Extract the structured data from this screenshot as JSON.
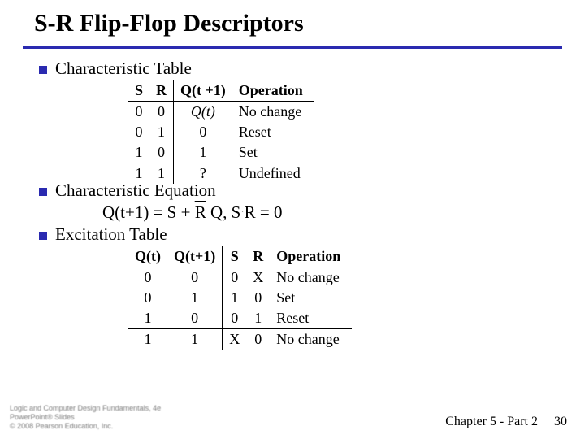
{
  "title": "S-R Flip-Flop Descriptors",
  "sections": {
    "char_table": "Characteristic Table",
    "char_eq": "Characteristic Equation",
    "excite": "Excitation Table"
  },
  "char_table": {
    "headers": {
      "s": "S",
      "r": "R",
      "q": "Q(t +1)",
      "op": "Operation"
    },
    "rows": [
      {
        "s": "0",
        "r": "0",
        "q": "Q(t)",
        "q_italic": true,
        "op": "No change"
      },
      {
        "s": "0",
        "r": "1",
        "q": "0",
        "q_italic": false,
        "op": "Reset"
      },
      {
        "s": "1",
        "r": "0",
        "q": "1",
        "q_italic": false,
        "op": "Set"
      }
    ],
    "last": {
      "s": "1",
      "r": "1",
      "q": "?",
      "op": "Undefined"
    }
  },
  "equation": {
    "lhs": "Q(t+1) = S + ",
    "rbar": "R",
    "mid": " Q, S",
    "dot": "·",
    "rhs": "R = 0"
  },
  "excite_table": {
    "headers": {
      "qt": "Q(t)",
      "qt1": "Q(t+1)",
      "s": "S",
      "r": "R",
      "op": "Operation"
    },
    "rows": [
      {
        "qt": "0",
        "qt1": "0",
        "s": "0",
        "r": "X",
        "op": "No change"
      },
      {
        "qt": "0",
        "qt1": "1",
        "s": "1",
        "r": "0",
        "op": "Set"
      },
      {
        "qt": "1",
        "qt1": "0",
        "s": "0",
        "r": "1",
        "op": "Reset"
      }
    ],
    "last": {
      "qt": "1",
      "qt1": "1",
      "s": "X",
      "r": "0",
      "op": "No change"
    }
  },
  "attribution": {
    "l1": "Logic and Computer Design Fundamentals, 4e",
    "l2": "PowerPoint® Slides",
    "l3": "© 2008 Pearson Education, Inc."
  },
  "footer": {
    "chapter": "Chapter 5 - Part 2",
    "page": "30"
  }
}
